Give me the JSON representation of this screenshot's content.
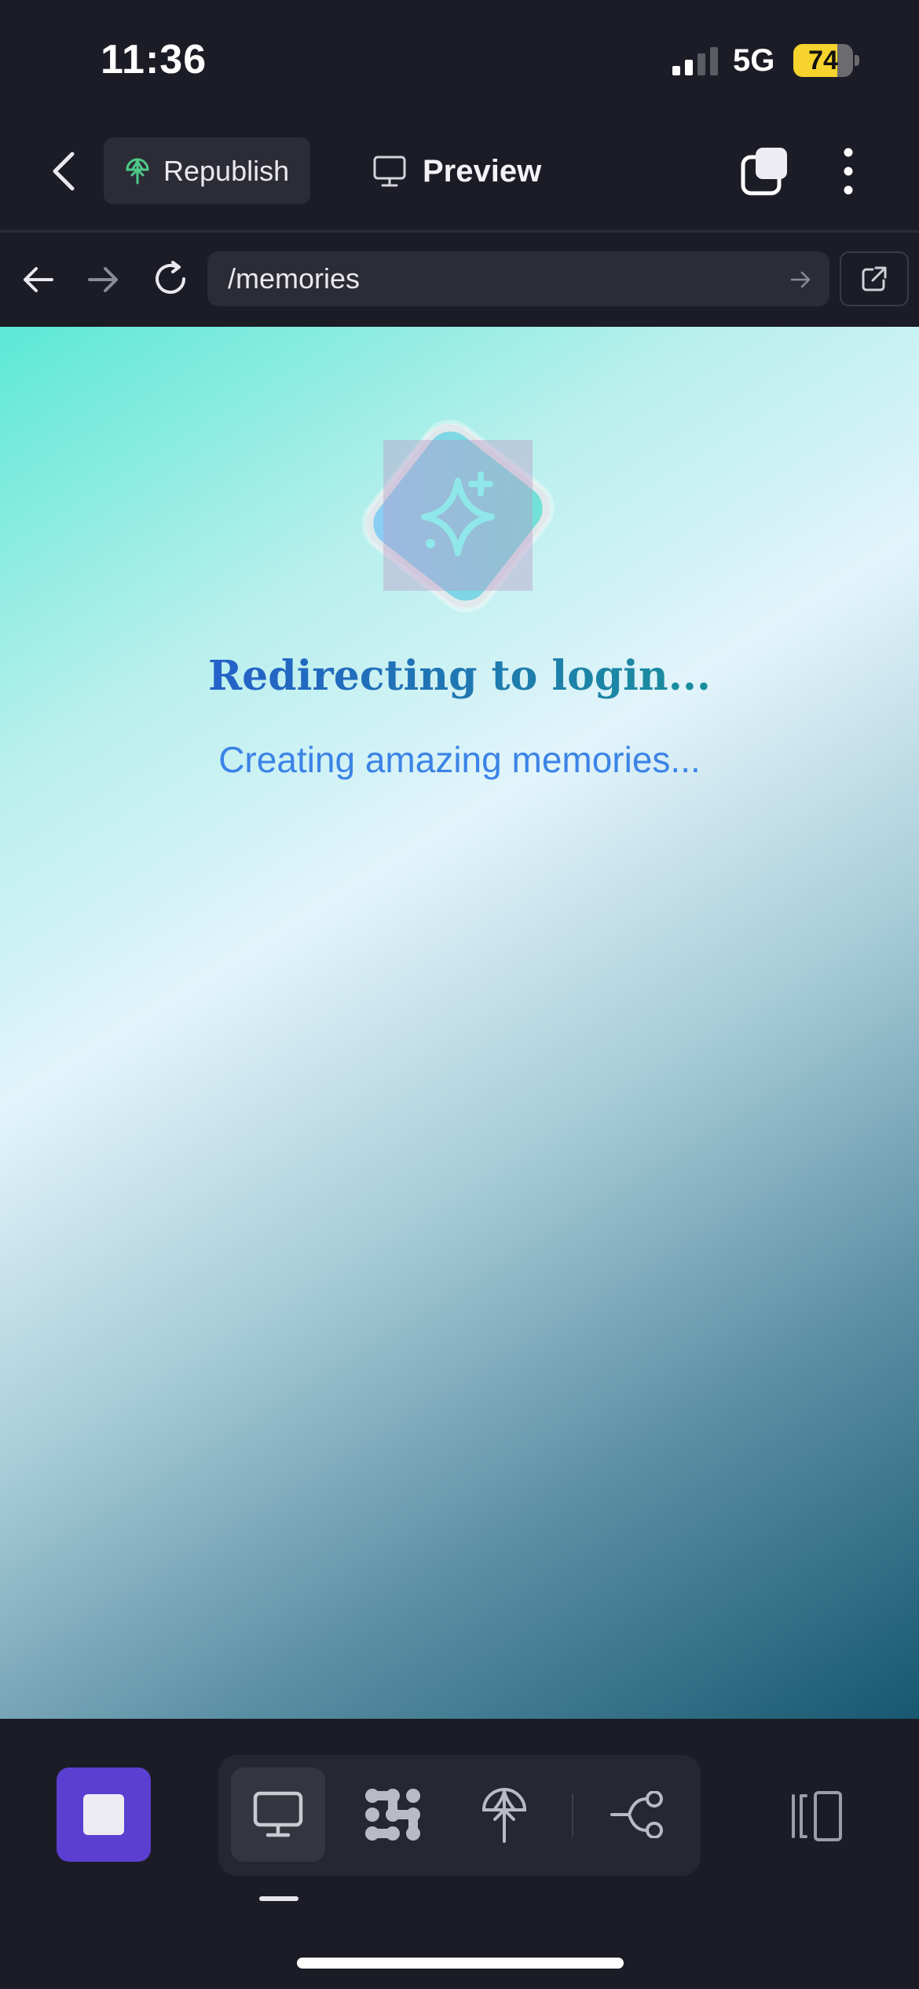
{
  "status_bar": {
    "time": "11:36",
    "network": "5G",
    "battery_level": "74",
    "battery_fraction": 0.74,
    "signal_bars_active": 2,
    "signal_bars_total": 4
  },
  "top_bar": {
    "republish_label": "Republish",
    "preview_label": "Preview",
    "icons": [
      "chevron-left-icon",
      "republish-icon",
      "monitor-icon",
      "tabs-icon",
      "more-vertical-icon"
    ]
  },
  "address_bar": {
    "url": "/memories",
    "icons": [
      "arrow-left-icon",
      "arrow-right-icon",
      "reload-icon",
      "go-arrow-icon",
      "external-link-icon"
    ]
  },
  "content": {
    "headline": "Redirecting to login...",
    "subline": "Creating amazing memories...",
    "logo_icon": "sparkles-icon"
  },
  "bottom_bar": {
    "tools": [
      "monitor-icon",
      "dots-grid-icon",
      "republish-icon",
      "branch-icon"
    ],
    "active_tool": "monitor-icon",
    "stop_icon": "stop-icon",
    "panel_icon": "panel-icon"
  },
  "colors": {
    "background": "#1b1c25",
    "surface": "#2b2c36",
    "accent_purple": "#5a3fd0",
    "headline_blue": "#2460c9",
    "subline_blue": "#3b83e6",
    "battery_yellow": "#f6d32d",
    "republish_green": "#4ec98a"
  }
}
